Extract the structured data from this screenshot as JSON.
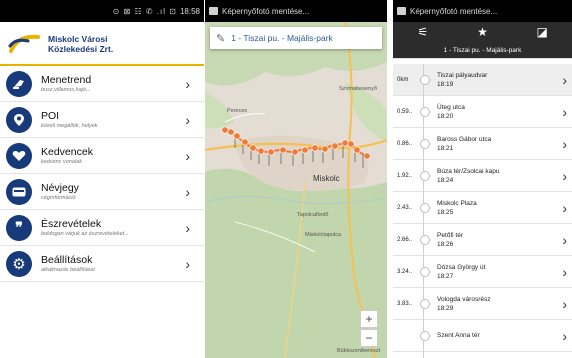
{
  "phone_status_left": {
    "indicators": "⊙ ⊠ ☷ ✆ .ıl ⊡",
    "time": "18:58"
  },
  "phone_status_middle": {
    "notification": "Képernyőfotó mentése..."
  },
  "phone_status_right": {
    "notification": "Képernyőfotó mentése..."
  },
  "brand": {
    "line1": "Miskolc Városi",
    "line2": "Közlekedési Zrt."
  },
  "menu": [
    {
      "title": "Menetrend",
      "subtitle": "busz,villamos,hajó...",
      "icon": "timetable-icon"
    },
    {
      "title": "POI",
      "subtitle": "közeli megállók, helyek",
      "icon": "location-pin-icon"
    },
    {
      "title": "Kedvencek",
      "subtitle": "kedvenc vonalak",
      "icon": "heart-icon"
    },
    {
      "title": "Névjegy",
      "subtitle": "cégínformáció",
      "icon": "card-icon"
    },
    {
      "title": "Észrevételek",
      "subtitle": "boldogan várjuk az észrevételeket...",
      "icon": "quote-icon"
    },
    {
      "title": "Beállítások",
      "subtitle": "alkalmazás beállításai",
      "icon": "settings-icon"
    }
  ],
  "map_view": {
    "route_label": "1 - Tiszai pu. - Majális-park",
    "labels": {
      "city": "Miskolc",
      "pereces": "Pereces",
      "szirmabesenyő": "Szirmabesenyő",
      "tapolca": "Tapolcafürdő",
      "miskolctapolca": "Miskolctapolca",
      "bottom": "Bükkszentkereszt"
    },
    "zoom_in": "+",
    "zoom_out": "−",
    "colors": {
      "route": "#f07a38",
      "road": "#f6c14f",
      "forest": "#c7d9b2",
      "land": "#e4ddd3"
    }
  },
  "stops_view": {
    "toolbar_icons": [
      "filter-icon",
      "star-icon",
      "map-toggle-icon"
    ],
    "route_title": "1 - Tiszai pu. - Majális-park",
    "stops": [
      {
        "dist": "0km",
        "name": "Tiszai pályaudvar",
        "time": "18:19"
      },
      {
        "dist": "0.59..",
        "name": "Üteg utca",
        "time": "18:20"
      },
      {
        "dist": "0.86..",
        "name": "Baross Gábor utca",
        "time": "18:21"
      },
      {
        "dist": "1.92..",
        "name": "Búza tér/Zsolcai kapu",
        "time": "18:24"
      },
      {
        "dist": "2.43..",
        "name": "Miskolc Plaza",
        "time": "18:25"
      },
      {
        "dist": "2.66..",
        "name": "Petőfi tér",
        "time": "18:26"
      },
      {
        "dist": "3.24..",
        "name": "Dózsa György út",
        "time": "18:27"
      },
      {
        "dist": "3.83..",
        "name": "Vologda városrész",
        "time": "18:29"
      },
      {
        "dist": "",
        "name": "Szent Anna tér",
        "time": ""
      }
    ]
  }
}
